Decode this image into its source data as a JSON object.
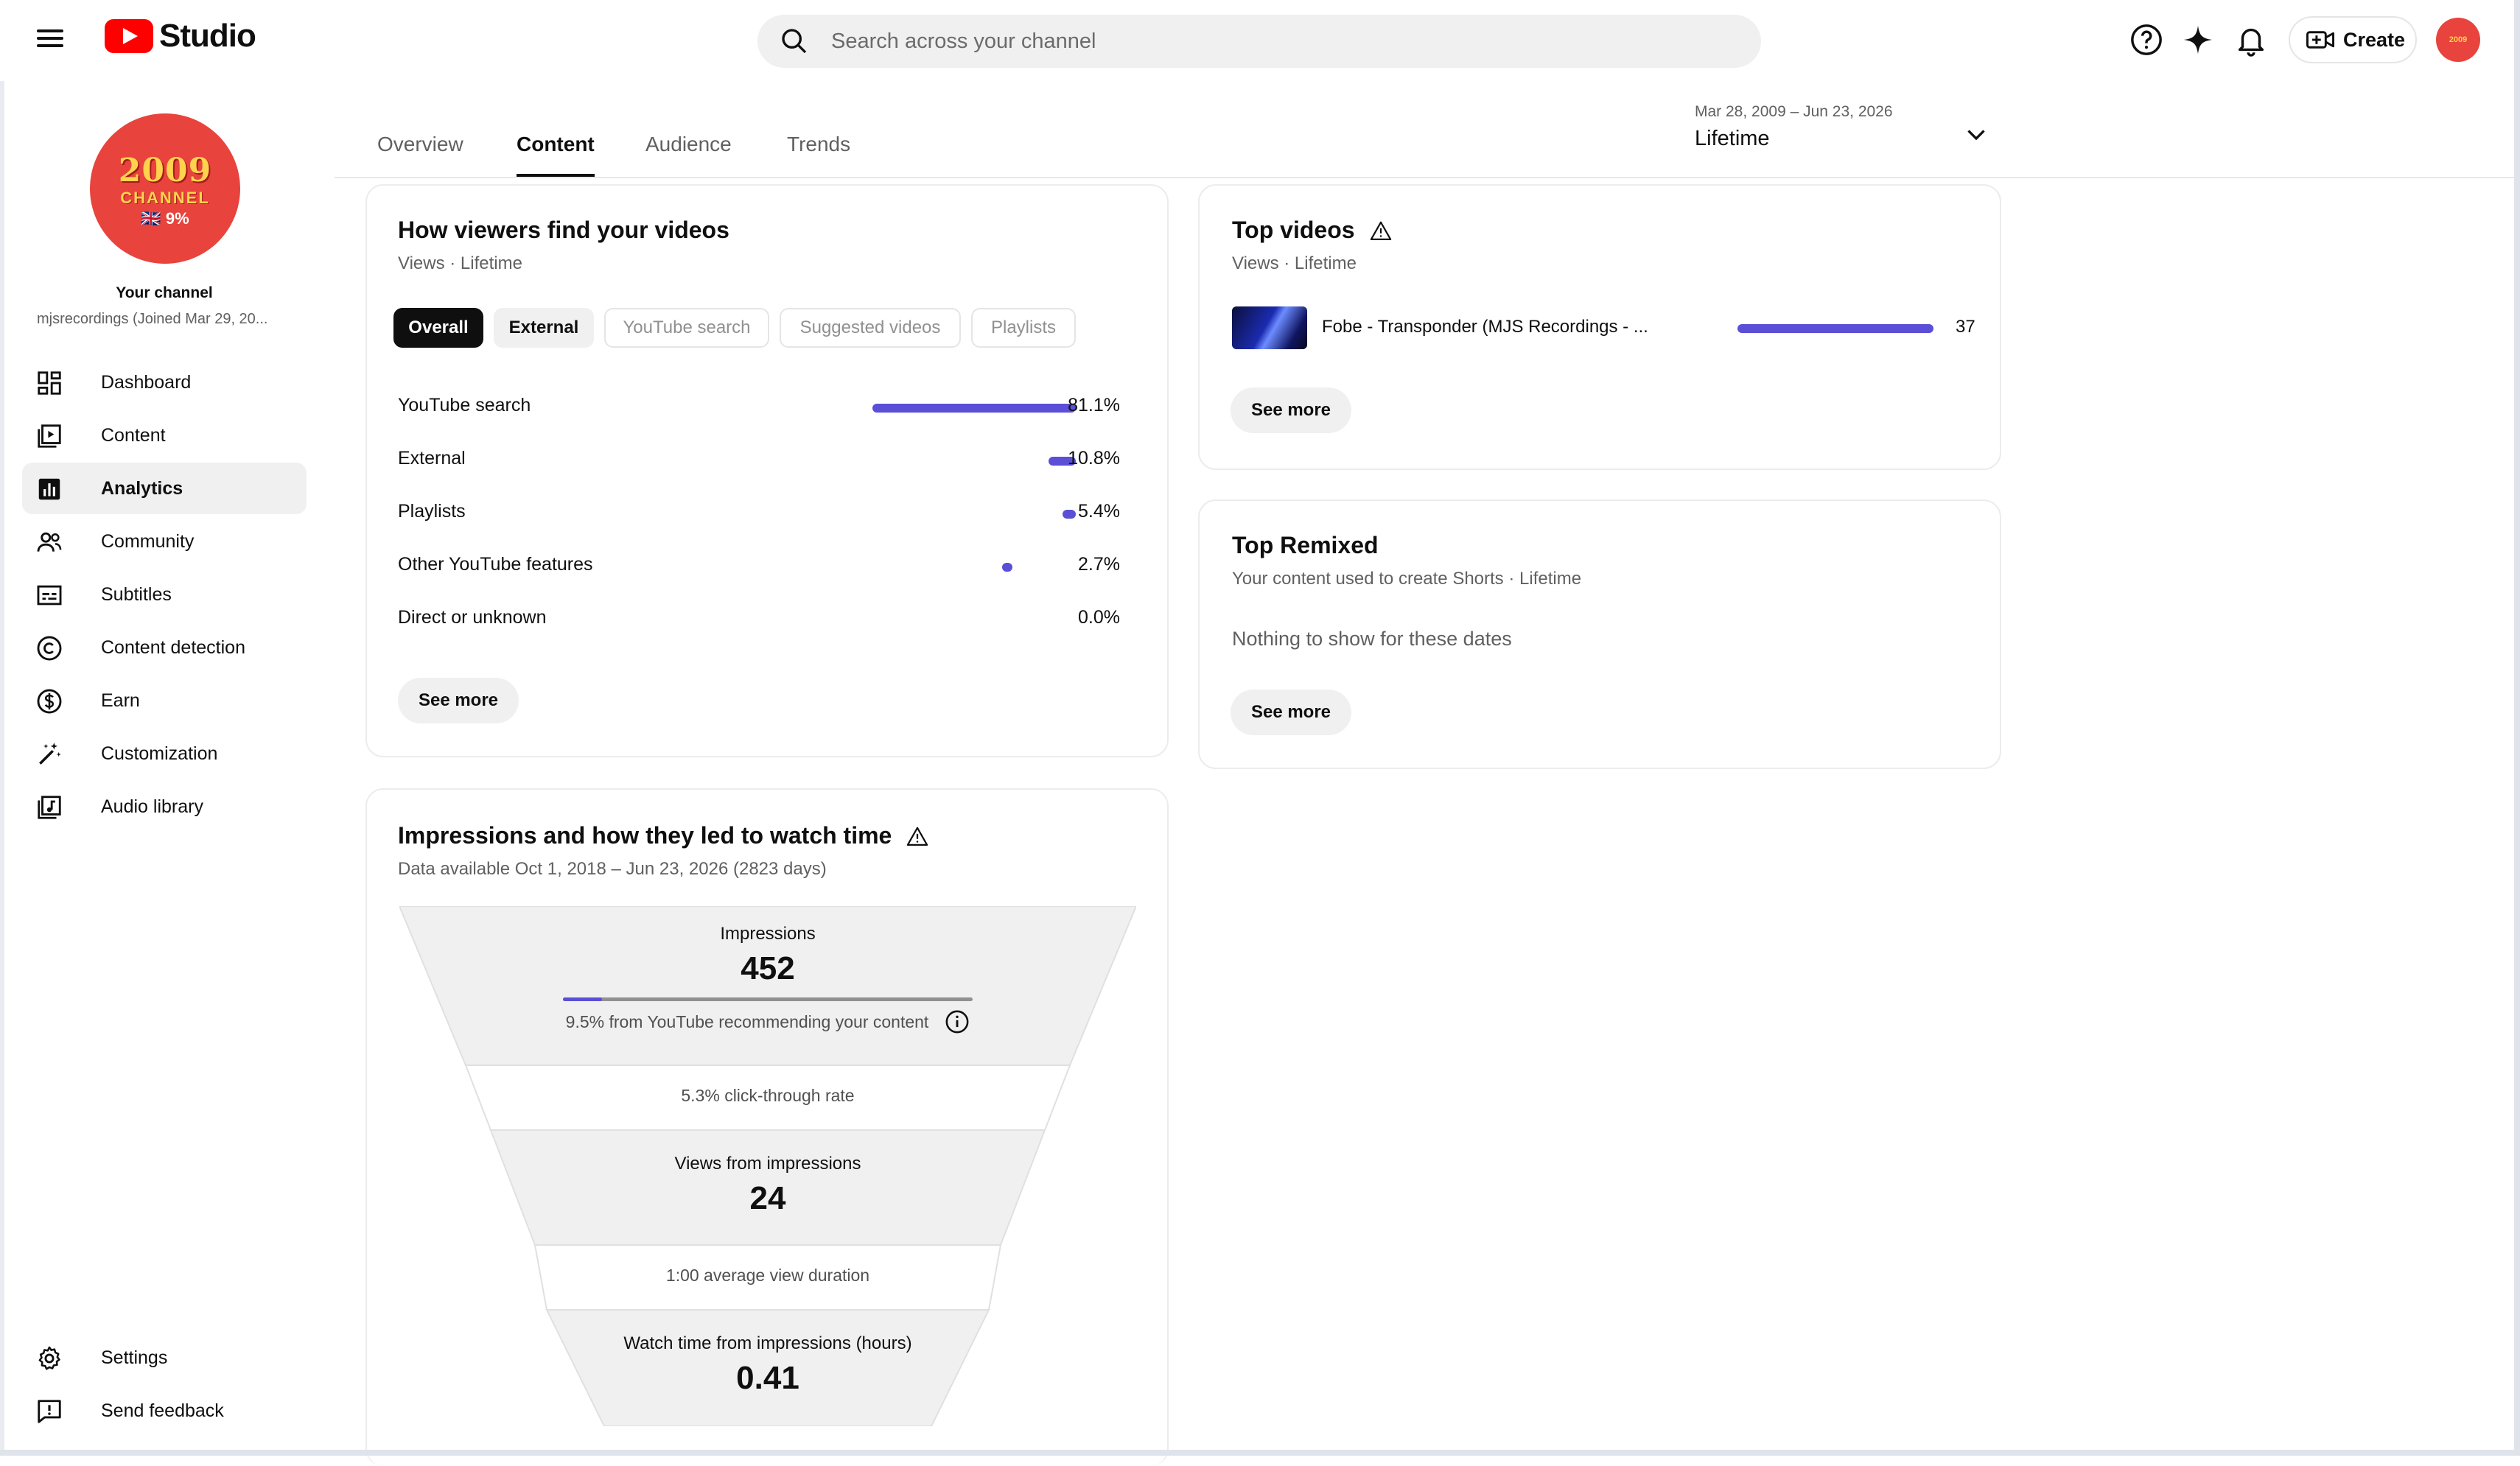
{
  "header": {
    "logo_text": "Studio",
    "search_placeholder": "Search across your channel",
    "create_label": "Create",
    "avatar_text": "2009"
  },
  "sidebar": {
    "channel_avatar": {
      "line1": "2009",
      "line2": "CHANNEL",
      "line3": "🇬🇧 9%"
    },
    "channel_title": "Your channel",
    "channel_subtitle": "mjsrecordings (Joined Mar 29, 20...",
    "items": [
      {
        "label": "Dashboard",
        "icon": "dashboard-icon"
      },
      {
        "label": "Content",
        "icon": "content-icon"
      },
      {
        "label": "Analytics",
        "icon": "analytics-icon",
        "active": true
      },
      {
        "label": "Community",
        "icon": "community-icon"
      },
      {
        "label": "Subtitles",
        "icon": "subtitles-icon"
      },
      {
        "label": "Content detection",
        "icon": "copyright-icon"
      },
      {
        "label": "Earn",
        "icon": "dollar-icon"
      },
      {
        "label": "Customization",
        "icon": "magic-wand-icon"
      },
      {
        "label": "Audio library",
        "icon": "audio-library-icon"
      }
    ],
    "bottom_items": [
      {
        "label": "Settings",
        "icon": "gear-icon"
      },
      {
        "label": "Send feedback",
        "icon": "feedback-icon"
      }
    ]
  },
  "tabs": [
    {
      "label": "Overview"
    },
    {
      "label": "Content",
      "active": true
    },
    {
      "label": "Audience"
    },
    {
      "label": "Trends"
    }
  ],
  "date_range": {
    "range": "Mar 28, 2009 – Jun 23, 2026",
    "label": "Lifetime"
  },
  "traffic_card": {
    "title": "How viewers find your videos",
    "subtitle": "Views · Lifetime",
    "chips": [
      "Overall",
      "External",
      "YouTube search",
      "Suggested videos",
      "Playlists"
    ],
    "rows": [
      {
        "label": "YouTube search",
        "value": "81.1%",
        "pct": 81.1
      },
      {
        "label": "External",
        "value": "10.8%",
        "pct": 10.8
      },
      {
        "label": "Playlists",
        "value": "5.4%",
        "pct": 5.4
      },
      {
        "label": "Other YouTube features",
        "value": "2.7%",
        "pct": 2.7
      },
      {
        "label": "Direct or unknown",
        "value": "0.0%",
        "pct": 0
      }
    ],
    "see_more": "See more"
  },
  "top_videos": {
    "title": "Top videos",
    "subtitle": "Views · Lifetime",
    "items": [
      {
        "title": "Fobe - Transponder (MJS Recordings - ...",
        "views": "37",
        "fraction": 1.0
      }
    ],
    "see_more": "See more"
  },
  "top_remixed": {
    "title": "Top Remixed",
    "subtitle": "Your content used to create Shorts · Lifetime",
    "empty": "Nothing to show for these dates",
    "see_more": "See more"
  },
  "impressions": {
    "title": "Impressions and how they led to watch time",
    "subtitle": "Data available Oct 1, 2018 – Jun 23, 2026 (2823 days)",
    "impressions_label": "Impressions",
    "impressions_value": "452",
    "recommend_text": "9.5% from YouTube recommending your content",
    "recommend_fraction": 0.095,
    "ctr_text": "5.3% click-through rate",
    "views_label": "Views from impressions",
    "views_value": "24",
    "avd_text": "1:00 average view duration",
    "watch_label": "Watch time from impressions (hours)",
    "watch_value": "0.41"
  }
}
